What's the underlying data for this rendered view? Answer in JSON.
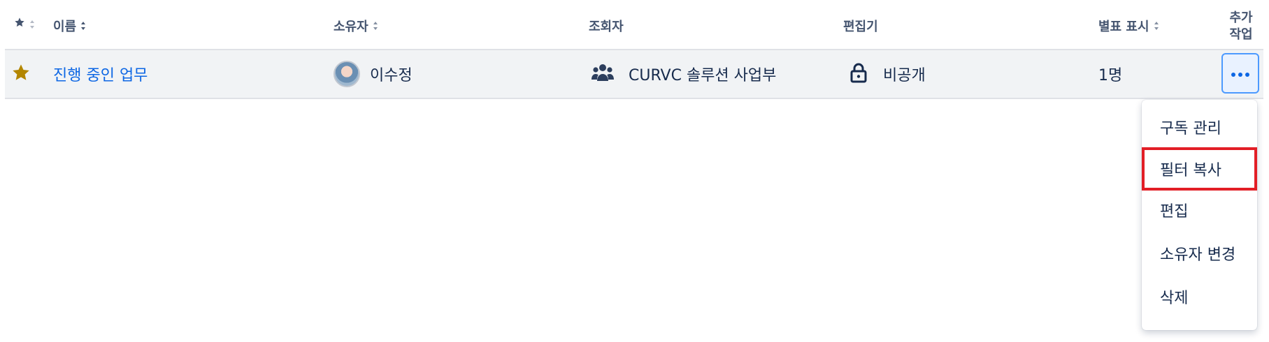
{
  "header": {
    "star_icon": "star-icon",
    "name": "이름",
    "owner": "소유자",
    "viewers": "조회자",
    "editors": "편집기",
    "starred_by": "별표 표시",
    "more_actions_line1": "추가",
    "more_actions_line2": "작업"
  },
  "row": {
    "starred": true,
    "name": "진행 중인 업무",
    "owner": "이수정",
    "viewers_icon": "people-group-icon",
    "viewers": "CURVC 솔루션 사업부",
    "editors_icon": "lock-icon",
    "editors": "비공개",
    "starred_count": "1명",
    "more_icon": "more-horizontal-icon"
  },
  "menu": {
    "items": [
      {
        "label": "구독 관리"
      },
      {
        "label": "필터 복사",
        "highlighted": true
      },
      {
        "label": "편집"
      },
      {
        "label": "소유자 변경"
      },
      {
        "label": "삭제"
      }
    ]
  },
  "colors": {
    "link": "#0c66e4",
    "star": "#b38600",
    "highlight_border": "#e21e26",
    "row_bg": "#f1f3f5",
    "focus": "#4c9aff"
  }
}
